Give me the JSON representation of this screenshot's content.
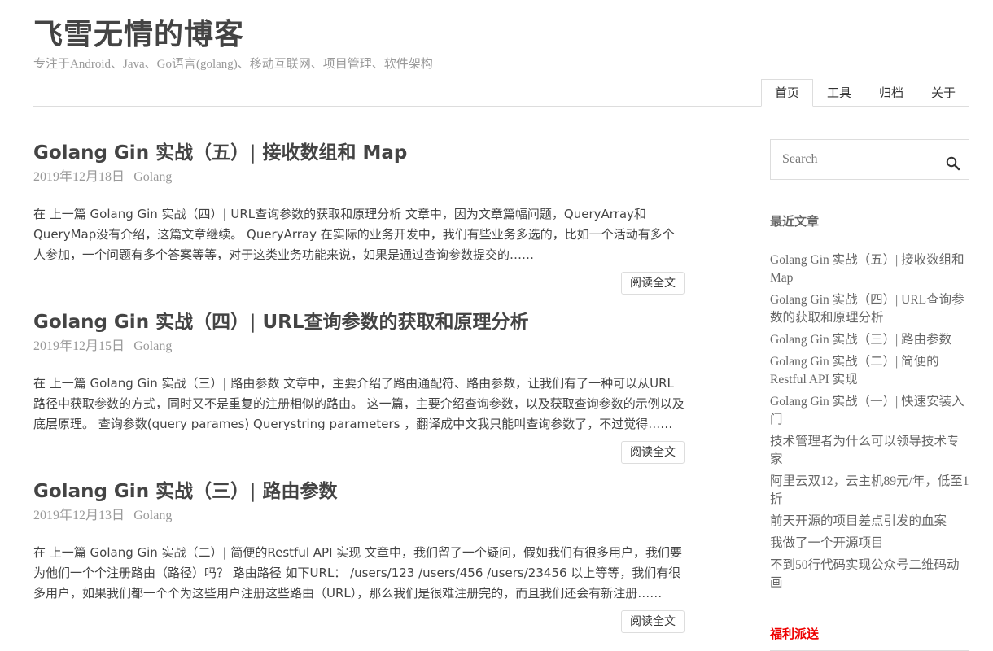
{
  "header": {
    "title": "飞雪无情的博客",
    "description": "专注于Android、Java、Go语言(golang)、移动互联网、项目管理、软件架构"
  },
  "nav": [
    {
      "label": "首页",
      "active": true
    },
    {
      "label": "工具"
    },
    {
      "label": "归档"
    },
    {
      "label": "关于"
    }
  ],
  "posts": [
    {
      "title": "Golang Gin 实战（五）| 接收数组和 Map",
      "date": "2019年12月18日",
      "separator": "|",
      "category": "Golang",
      "excerpt": "在 上一篇 Golang Gin 实战（四）| URL查询参数的获取和原理分析 文章中，因为文章篇幅问题，QueryArray和QueryMap没有介绍，这篇文章继续。 QueryArray 在实际的业务开发中，我们有些业务多选的，比如一个活动有多个人参加，一个问题有多个答案等等，对于这类业务功能来说，如果是通过查询参数提交的……",
      "read_more": "阅读全文"
    },
    {
      "title": "Golang Gin 实战（四）| URL查询参数的获取和原理分析",
      "date": "2019年12月15日",
      "separator": "|",
      "category": "Golang",
      "excerpt": "在 上一篇 Golang Gin 实战（三）| 路由参数 文章中，主要介绍了路由通配符、路由参数，让我们有了一种可以从URL路径中获取参数的方式，同时又不是重复的注册相似的路由。 这一篇，主要介绍查询参数，以及获取查询参数的示例以及底层原理。 查询参数(query parames) Querystring parameters ，翻译成中文我只能叫查询参数了，不过觉得……",
      "read_more": "阅读全文"
    },
    {
      "title": "Golang Gin 实战（三）| 路由参数",
      "date": "2019年12月13日",
      "separator": "|",
      "category": "Golang",
      "excerpt": "在 上一篇 Golang Gin 实战（二）| 简便的Restful API 实现 文章中，我们留了一个疑问，假如我们有很多用户，我们要为他们一个个注册路由（路径）吗？ 路由路径 如下URL： /users/123 /users/456 /users/23456 以上等等，我们有很多用户，如果我们都一个个为这些用户注册这些路由（URL），那么我们是很难注册完的，而且我们还会有新注册……",
      "read_more": "阅读全文"
    }
  ],
  "sidebar": {
    "search_placeholder": "Search",
    "recent_title": "最近文章",
    "recent": [
      "Golang Gin 实战（五）| 接收数组和 Map",
      "Golang Gin 实战（四）| URL查询参数的获取和原理分析",
      "Golang Gin 实战（三）| 路由参数",
      "Golang Gin 实战（二）| 简便的 Restful API 实现",
      "Golang Gin 实战（一）| 快速安装入门",
      "技术管理者为什么可以领导技术专家",
      "阿里云双12，云主机89元/年，低至1折",
      "前天开源的项目差点引发的血案",
      "我做了一个开源项目",
      "不到50行代码实现公众号二维码动画"
    ],
    "welfare_title": "福利派送"
  },
  "colors": {
    "accent_red": "#e00000",
    "text": "#444444",
    "muted": "#999999",
    "border": "#dddddd"
  }
}
